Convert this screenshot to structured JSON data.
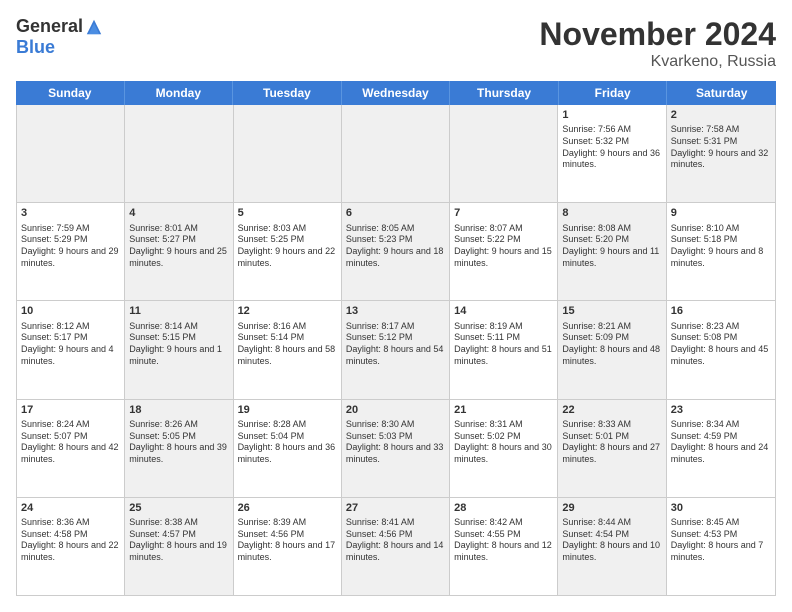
{
  "header": {
    "logo_general": "General",
    "logo_blue": "Blue",
    "month_title": "November 2024",
    "location": "Kvarkeno, Russia"
  },
  "days_of_week": [
    "Sunday",
    "Monday",
    "Tuesday",
    "Wednesday",
    "Thursday",
    "Friday",
    "Saturday"
  ],
  "weeks": [
    [
      {
        "day": "",
        "info": "",
        "shaded": true
      },
      {
        "day": "",
        "info": "",
        "shaded": true
      },
      {
        "day": "",
        "info": "",
        "shaded": true
      },
      {
        "day": "",
        "info": "",
        "shaded": true
      },
      {
        "day": "",
        "info": "",
        "shaded": true
      },
      {
        "day": "1",
        "info": "Sunrise: 7:56 AM\nSunset: 5:32 PM\nDaylight: 9 hours and 36 minutes.",
        "shaded": false
      },
      {
        "day": "2",
        "info": "Sunrise: 7:58 AM\nSunset: 5:31 PM\nDaylight: 9 hours and 32 minutes.",
        "shaded": true
      }
    ],
    [
      {
        "day": "3",
        "info": "Sunrise: 7:59 AM\nSunset: 5:29 PM\nDaylight: 9 hours and 29 minutes.",
        "shaded": false
      },
      {
        "day": "4",
        "info": "Sunrise: 8:01 AM\nSunset: 5:27 PM\nDaylight: 9 hours and 25 minutes.",
        "shaded": true
      },
      {
        "day": "5",
        "info": "Sunrise: 8:03 AM\nSunset: 5:25 PM\nDaylight: 9 hours and 22 minutes.",
        "shaded": false
      },
      {
        "day": "6",
        "info": "Sunrise: 8:05 AM\nSunset: 5:23 PM\nDaylight: 9 hours and 18 minutes.",
        "shaded": true
      },
      {
        "day": "7",
        "info": "Sunrise: 8:07 AM\nSunset: 5:22 PM\nDaylight: 9 hours and 15 minutes.",
        "shaded": false
      },
      {
        "day": "8",
        "info": "Sunrise: 8:08 AM\nSunset: 5:20 PM\nDaylight: 9 hours and 11 minutes.",
        "shaded": true
      },
      {
        "day": "9",
        "info": "Sunrise: 8:10 AM\nSunset: 5:18 PM\nDaylight: 9 hours and 8 minutes.",
        "shaded": false
      }
    ],
    [
      {
        "day": "10",
        "info": "Sunrise: 8:12 AM\nSunset: 5:17 PM\nDaylight: 9 hours and 4 minutes.",
        "shaded": false
      },
      {
        "day": "11",
        "info": "Sunrise: 8:14 AM\nSunset: 5:15 PM\nDaylight: 9 hours and 1 minute.",
        "shaded": true
      },
      {
        "day": "12",
        "info": "Sunrise: 8:16 AM\nSunset: 5:14 PM\nDaylight: 8 hours and 58 minutes.",
        "shaded": false
      },
      {
        "day": "13",
        "info": "Sunrise: 8:17 AM\nSunset: 5:12 PM\nDaylight: 8 hours and 54 minutes.",
        "shaded": true
      },
      {
        "day": "14",
        "info": "Sunrise: 8:19 AM\nSunset: 5:11 PM\nDaylight: 8 hours and 51 minutes.",
        "shaded": false
      },
      {
        "day": "15",
        "info": "Sunrise: 8:21 AM\nSunset: 5:09 PM\nDaylight: 8 hours and 48 minutes.",
        "shaded": true
      },
      {
        "day": "16",
        "info": "Sunrise: 8:23 AM\nSunset: 5:08 PM\nDaylight: 8 hours and 45 minutes.",
        "shaded": false
      }
    ],
    [
      {
        "day": "17",
        "info": "Sunrise: 8:24 AM\nSunset: 5:07 PM\nDaylight: 8 hours and 42 minutes.",
        "shaded": false
      },
      {
        "day": "18",
        "info": "Sunrise: 8:26 AM\nSunset: 5:05 PM\nDaylight: 8 hours and 39 minutes.",
        "shaded": true
      },
      {
        "day": "19",
        "info": "Sunrise: 8:28 AM\nSunset: 5:04 PM\nDaylight: 8 hours and 36 minutes.",
        "shaded": false
      },
      {
        "day": "20",
        "info": "Sunrise: 8:30 AM\nSunset: 5:03 PM\nDaylight: 8 hours and 33 minutes.",
        "shaded": true
      },
      {
        "day": "21",
        "info": "Sunrise: 8:31 AM\nSunset: 5:02 PM\nDaylight: 8 hours and 30 minutes.",
        "shaded": false
      },
      {
        "day": "22",
        "info": "Sunrise: 8:33 AM\nSunset: 5:01 PM\nDaylight: 8 hours and 27 minutes.",
        "shaded": true
      },
      {
        "day": "23",
        "info": "Sunrise: 8:34 AM\nSunset: 4:59 PM\nDaylight: 8 hours and 24 minutes.",
        "shaded": false
      }
    ],
    [
      {
        "day": "24",
        "info": "Sunrise: 8:36 AM\nSunset: 4:58 PM\nDaylight: 8 hours and 22 minutes.",
        "shaded": false
      },
      {
        "day": "25",
        "info": "Sunrise: 8:38 AM\nSunset: 4:57 PM\nDaylight: 8 hours and 19 minutes.",
        "shaded": true
      },
      {
        "day": "26",
        "info": "Sunrise: 8:39 AM\nSunset: 4:56 PM\nDaylight: 8 hours and 17 minutes.",
        "shaded": false
      },
      {
        "day": "27",
        "info": "Sunrise: 8:41 AM\nSunset: 4:56 PM\nDaylight: 8 hours and 14 minutes.",
        "shaded": true
      },
      {
        "day": "28",
        "info": "Sunrise: 8:42 AM\nSunset: 4:55 PM\nDaylight: 8 hours and 12 minutes.",
        "shaded": false
      },
      {
        "day": "29",
        "info": "Sunrise: 8:44 AM\nSunset: 4:54 PM\nDaylight: 8 hours and 10 minutes.",
        "shaded": true
      },
      {
        "day": "30",
        "info": "Sunrise: 8:45 AM\nSunset: 4:53 PM\nDaylight: 8 hours and 7 minutes.",
        "shaded": false
      }
    ]
  ]
}
